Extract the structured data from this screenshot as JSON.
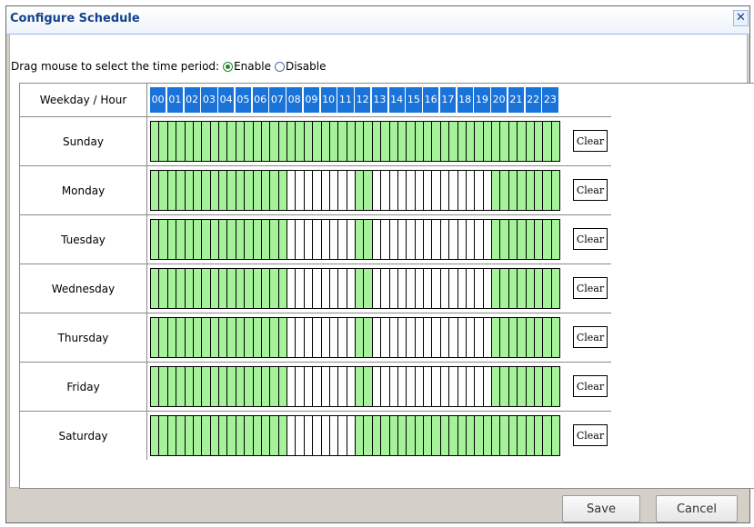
{
  "dialog": {
    "title": "Configure Schedule",
    "close_glyph": "✕",
    "instruction": "Drag mouse to select the time period:",
    "radio_enable": "Enable",
    "radio_disable": "Disable",
    "selected_mode": "Enable"
  },
  "grid": {
    "header_label": "Weekday / Hour",
    "hours": [
      "00",
      "01",
      "02",
      "03",
      "04",
      "05",
      "06",
      "07",
      "08",
      "09",
      "10",
      "11",
      "12",
      "13",
      "14",
      "15",
      "16",
      "17",
      "18",
      "19",
      "20",
      "21",
      "22",
      "23"
    ],
    "days": [
      {
        "label": "Sunday",
        "on": [
          0,
          0,
          0,
          0,
          0,
          0,
          0,
          0,
          0,
          0,
          0,
          0,
          0,
          0,
          0,
          0,
          0,
          0,
          0,
          0,
          0,
          0,
          0,
          0,
          0,
          0,
          0,
          0,
          0,
          0,
          0,
          0,
          0,
          0,
          0,
          0,
          0,
          0,
          0,
          0,
          0,
          0,
          0,
          0,
          0,
          0,
          0,
          0
        ]
      },
      {
        "label": "Monday",
        "on": [
          0,
          0,
          0,
          0,
          0,
          0,
          0,
          0,
          0,
          0,
          0,
          0,
          0,
          0,
          0,
          0,
          1,
          1,
          1,
          1,
          1,
          1,
          1,
          1,
          0,
          0,
          1,
          1,
          1,
          1,
          1,
          1,
          1,
          1,
          1,
          1,
          1,
          1,
          1,
          1,
          0,
          0,
          0,
          0,
          0,
          0,
          0,
          0
        ]
      },
      {
        "label": "Tuesday",
        "on": [
          0,
          0,
          0,
          0,
          0,
          0,
          0,
          0,
          0,
          0,
          0,
          0,
          0,
          0,
          0,
          0,
          1,
          1,
          1,
          1,
          1,
          1,
          1,
          1,
          0,
          0,
          1,
          1,
          1,
          1,
          1,
          1,
          1,
          1,
          1,
          1,
          1,
          1,
          1,
          1,
          0,
          0,
          0,
          0,
          0,
          0,
          0,
          0
        ]
      },
      {
        "label": "Wednesday",
        "on": [
          0,
          0,
          0,
          0,
          0,
          0,
          0,
          0,
          0,
          0,
          0,
          0,
          0,
          0,
          0,
          0,
          1,
          1,
          1,
          1,
          1,
          1,
          1,
          1,
          0,
          0,
          1,
          1,
          1,
          1,
          1,
          1,
          1,
          1,
          1,
          1,
          1,
          1,
          1,
          1,
          0,
          0,
          0,
          0,
          0,
          0,
          0,
          0
        ]
      },
      {
        "label": "Thursday",
        "on": [
          0,
          0,
          0,
          0,
          0,
          0,
          0,
          0,
          0,
          0,
          0,
          0,
          0,
          0,
          0,
          0,
          1,
          1,
          1,
          1,
          1,
          1,
          1,
          1,
          0,
          0,
          1,
          1,
          1,
          1,
          1,
          1,
          1,
          1,
          1,
          1,
          1,
          1,
          1,
          1,
          0,
          0,
          0,
          0,
          0,
          0,
          0,
          0
        ]
      },
      {
        "label": "Friday",
        "on": [
          0,
          0,
          0,
          0,
          0,
          0,
          0,
          0,
          0,
          0,
          0,
          0,
          0,
          0,
          0,
          0,
          1,
          1,
          1,
          1,
          1,
          1,
          1,
          1,
          0,
          0,
          1,
          1,
          1,
          1,
          1,
          1,
          1,
          1,
          1,
          1,
          1,
          1,
          1,
          1,
          0,
          0,
          0,
          0,
          0,
          0,
          0,
          0
        ]
      },
      {
        "label": "Saturday",
        "on": [
          0,
          0,
          0,
          0,
          0,
          0,
          0,
          0,
          0,
          0,
          0,
          0,
          0,
          0,
          0,
          0,
          1,
          1,
          1,
          1,
          1,
          1,
          1,
          1,
          0,
          0,
          0,
          0,
          0,
          0,
          0,
          0,
          0,
          0,
          0,
          0,
          0,
          0,
          0,
          0,
          0,
          0,
          0,
          0,
          0,
          0,
          0,
          0
        ]
      }
    ],
    "clear_label": "Clear"
  },
  "footer": {
    "save_label": "Save",
    "cancel_label": "Cancel"
  },
  "colors": {
    "enabled_cell": "#a5f29a",
    "disabled_cell": "#ffffff",
    "hour_header": "#1a73d9",
    "title_text": "#15428b"
  }
}
